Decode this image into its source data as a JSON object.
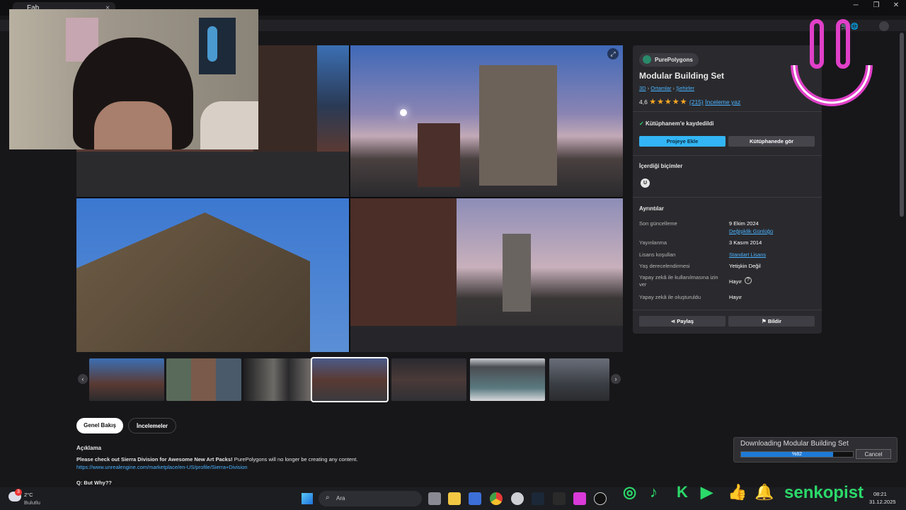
{
  "browser": {
    "tab_title": "Fab",
    "close_glyph": "×",
    "minimize_glyph": "─",
    "maximize_glyph": "❐",
    "window_close_glyph": "✕"
  },
  "product": {
    "seller": "PurePolygons",
    "title": "Modular Building Set",
    "breadcrumb": [
      "3D",
      "Ortamlar",
      "Şehirler"
    ],
    "rating": "4,6",
    "review_count": "(215)",
    "write_review": "İnceleme yaz",
    "saved_text": "Kütüphanem'e kaydedildi",
    "add_to_project": "Projeye Ekle",
    "view_in_library": "Kütüphanede gör",
    "formats_heading": "İçerdiği biçimler",
    "details_heading": "Ayrıntılar",
    "details": [
      {
        "label": "Son güncelleme",
        "value": "9 Ekim 2024",
        "link": "Değişiklik Günlüğü"
      },
      {
        "label": "Yayınlanma",
        "value": "3 Kasım 2014"
      },
      {
        "label": "Lisans koşulları",
        "value": "Standart Lisans"
      },
      {
        "label": "Yaş derecelendirmesi",
        "value": "Yetişkin Değil"
      },
      {
        "label": "Yapay zekâ ile kullanılmasına izin ver",
        "value": "Hayır"
      },
      {
        "label": "Yapay zekâ ile oluşturuldu",
        "value": "Hayır"
      }
    ],
    "share": "Paylaş",
    "report": "Bildir"
  },
  "tabs": [
    "Genel Bakış",
    "İncelemeler"
  ],
  "description": {
    "heading": "Açıklama",
    "bold_text": "Please check out Sierra Division for Awesome New Art Packs!",
    "text": " PurePolygons will no longer be creating any content.",
    "link": "https://www.unrealengine.com/marketplace/en-US/profile/Sierra+Division",
    "question": "Q: But Why??"
  },
  "download": {
    "title": "Downloading Modular Building Set",
    "percent_label": "%82",
    "progress": 0.82,
    "cancel": "Cancel"
  },
  "taskbar": {
    "temp": "2°C",
    "weather": "Bulutlu",
    "search": "Ara",
    "time": "08:21",
    "date": "31.12.2025",
    "notif_count": "3"
  },
  "overlay": {
    "handle": "senkopist"
  },
  "colors": {
    "accent": "#33b5f5",
    "star": "#f5a623",
    "green": "#2bd96a",
    "smiley": "#e040c8"
  }
}
